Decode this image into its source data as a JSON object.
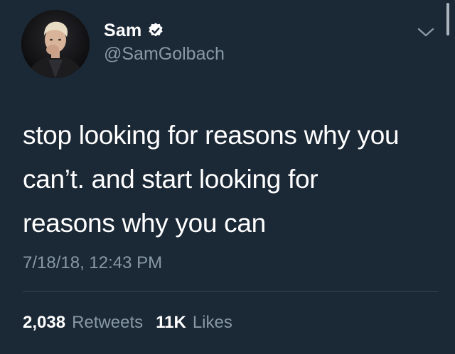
{
  "author": {
    "display_name": "Sam",
    "handle": "@SamGolbach",
    "verified": true
  },
  "tweet": {
    "lines": [
      "stop looking for reasons why you",
      "can’t. and start looking for",
      "reasons why you can"
    ],
    "timestamp": "7/18/18, 12:43 PM"
  },
  "stats": {
    "retweets_count": "2,038",
    "retweets_label": "Retweets",
    "likes_count": "11K",
    "likes_label": "Likes"
  },
  "icons": {
    "verified": "verified-badge-icon",
    "menu": "chevron-down-icon"
  },
  "colors": {
    "background": "#1b2836",
    "secondary_text": "#8899a6",
    "primary_text": "#ffffff"
  }
}
